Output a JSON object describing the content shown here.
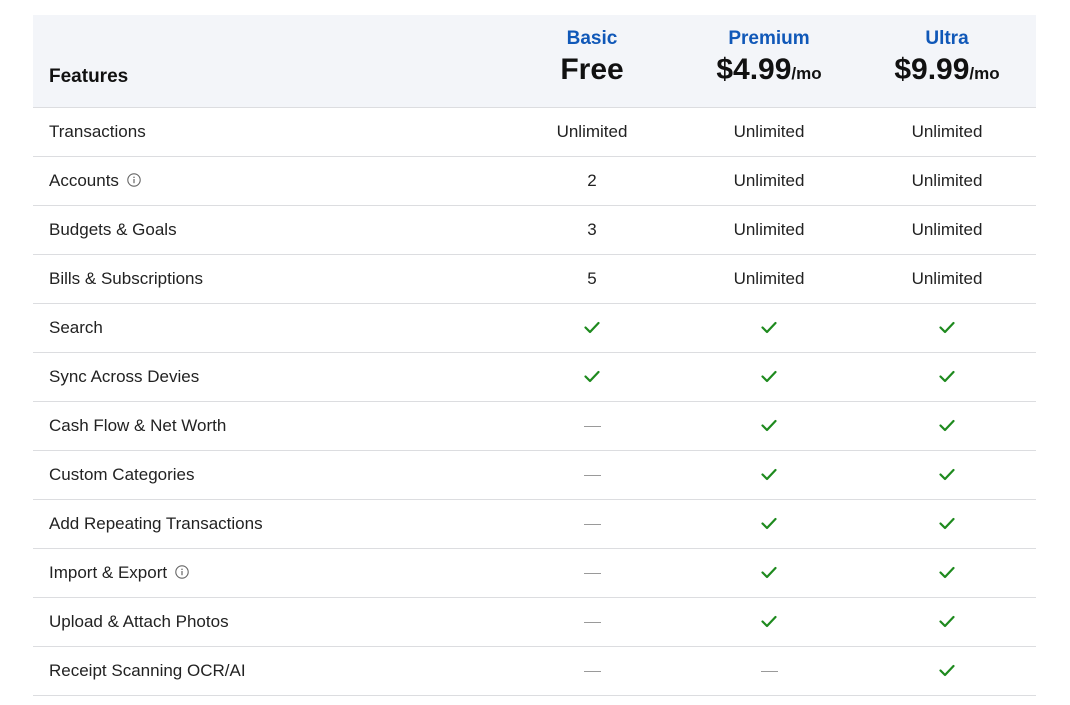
{
  "header": {
    "features_label": "Features",
    "plans": [
      {
        "name": "Basic",
        "price": "Free",
        "per": ""
      },
      {
        "name": "Premium",
        "price": "$4.99",
        "per": "/mo"
      },
      {
        "name": "Ultra",
        "price": "$9.99",
        "per": "/mo"
      }
    ]
  },
  "rows": [
    {
      "feature": "Transactions",
      "info": false,
      "values": [
        "Unlimited",
        "Unlimited",
        "Unlimited"
      ]
    },
    {
      "feature": "Accounts",
      "info": true,
      "values": [
        "2",
        "Unlimited",
        "Unlimited"
      ]
    },
    {
      "feature": "Budgets & Goals",
      "info": false,
      "values": [
        "3",
        "Unlimited",
        "Unlimited"
      ]
    },
    {
      "feature": "Bills & Subscriptions",
      "info": false,
      "values": [
        "5",
        "Unlimited",
        "Unlimited"
      ]
    },
    {
      "feature": "Search",
      "info": false,
      "values": [
        "check",
        "check",
        "check"
      ]
    },
    {
      "feature": "Sync Across Devies",
      "info": false,
      "values": [
        "check",
        "check",
        "check"
      ]
    },
    {
      "feature": "Cash Flow & Net Worth",
      "info": false,
      "values": [
        "dash",
        "check",
        "check"
      ]
    },
    {
      "feature": "Custom Categories",
      "info": false,
      "values": [
        "dash",
        "check",
        "check"
      ]
    },
    {
      "feature": "Add Repeating Transactions",
      "info": false,
      "values": [
        "dash",
        "check",
        "check"
      ]
    },
    {
      "feature": "Import & Export",
      "info": true,
      "values": [
        "dash",
        "check",
        "check"
      ]
    },
    {
      "feature": "Upload & Attach Photos",
      "info": false,
      "values": [
        "dash",
        "check",
        "check"
      ]
    },
    {
      "feature": "Receipt Scanning OCR/AI",
      "info": false,
      "values": [
        "dash",
        "dash",
        "check"
      ]
    }
  ],
  "icons": {
    "check": "check-icon",
    "dash": "dash-icon",
    "info": "info-circle-icon"
  },
  "colors": {
    "plan_name": "#1058b8",
    "check": "#1e8a1e",
    "header_bg": "#f3f5f9",
    "divider": "#dcdde0"
  }
}
